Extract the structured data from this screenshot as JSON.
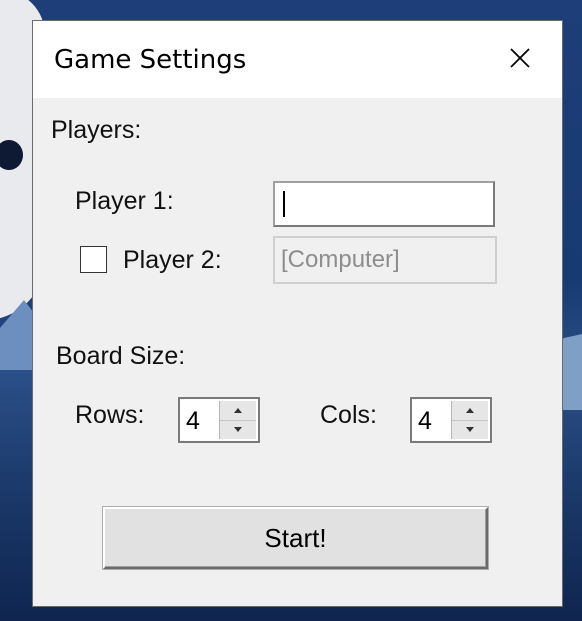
{
  "window": {
    "title": "Game Settings",
    "close_icon": "close-icon"
  },
  "players": {
    "section_label": "Players:",
    "player1_label": "Player 1:",
    "player1_value": "",
    "player2_label": "Player 2:",
    "player2_checked": false,
    "player2_value": "[Computer]",
    "player2_enabled": false
  },
  "board": {
    "section_label": "Board Size:",
    "rows_label": "Rows:",
    "rows_value": "4",
    "cols_label": "Cols:",
    "cols_value": "4"
  },
  "start_label": "Start!"
}
